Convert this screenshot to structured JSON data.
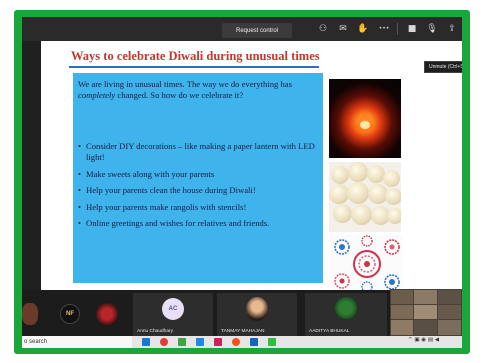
{
  "toolbar": {
    "request_control_label": "Request control",
    "unmute_tooltip": "Unmute (Ctrl+Shift+",
    "more_label": "•••"
  },
  "slide": {
    "title": "Ways to celebrate Diwali during unusual times",
    "intro_before": "We are living in unusual times. The way we do everything has ",
    "intro_emph": "completely",
    "intro_after": " changed. So how do we celebrate it?",
    "bullets": [
      "Consider DIY decorations – like making a paper lantern with LED light!",
      "Make sweets along with your parents",
      "Help your parents clean the house during Diwali!",
      "Help your parents make rangolis with stencils!",
      "Online greetings and wishes for relatives and friends."
    ]
  },
  "participants": {
    "tile1_initials": "NF",
    "tile2_initials": "AC",
    "tile2_name": "Annu Chaudhary",
    "tile3_name": "TANMAY MAHAJAN",
    "tile4_name": "AADITYA BHUKAL"
  },
  "taskbar": {
    "search_text": "o search"
  },
  "colors": {
    "frame_green": "#1aa63a",
    "slide_title_red": "#c0392b",
    "textbox_blue": "#3fb3ec"
  }
}
